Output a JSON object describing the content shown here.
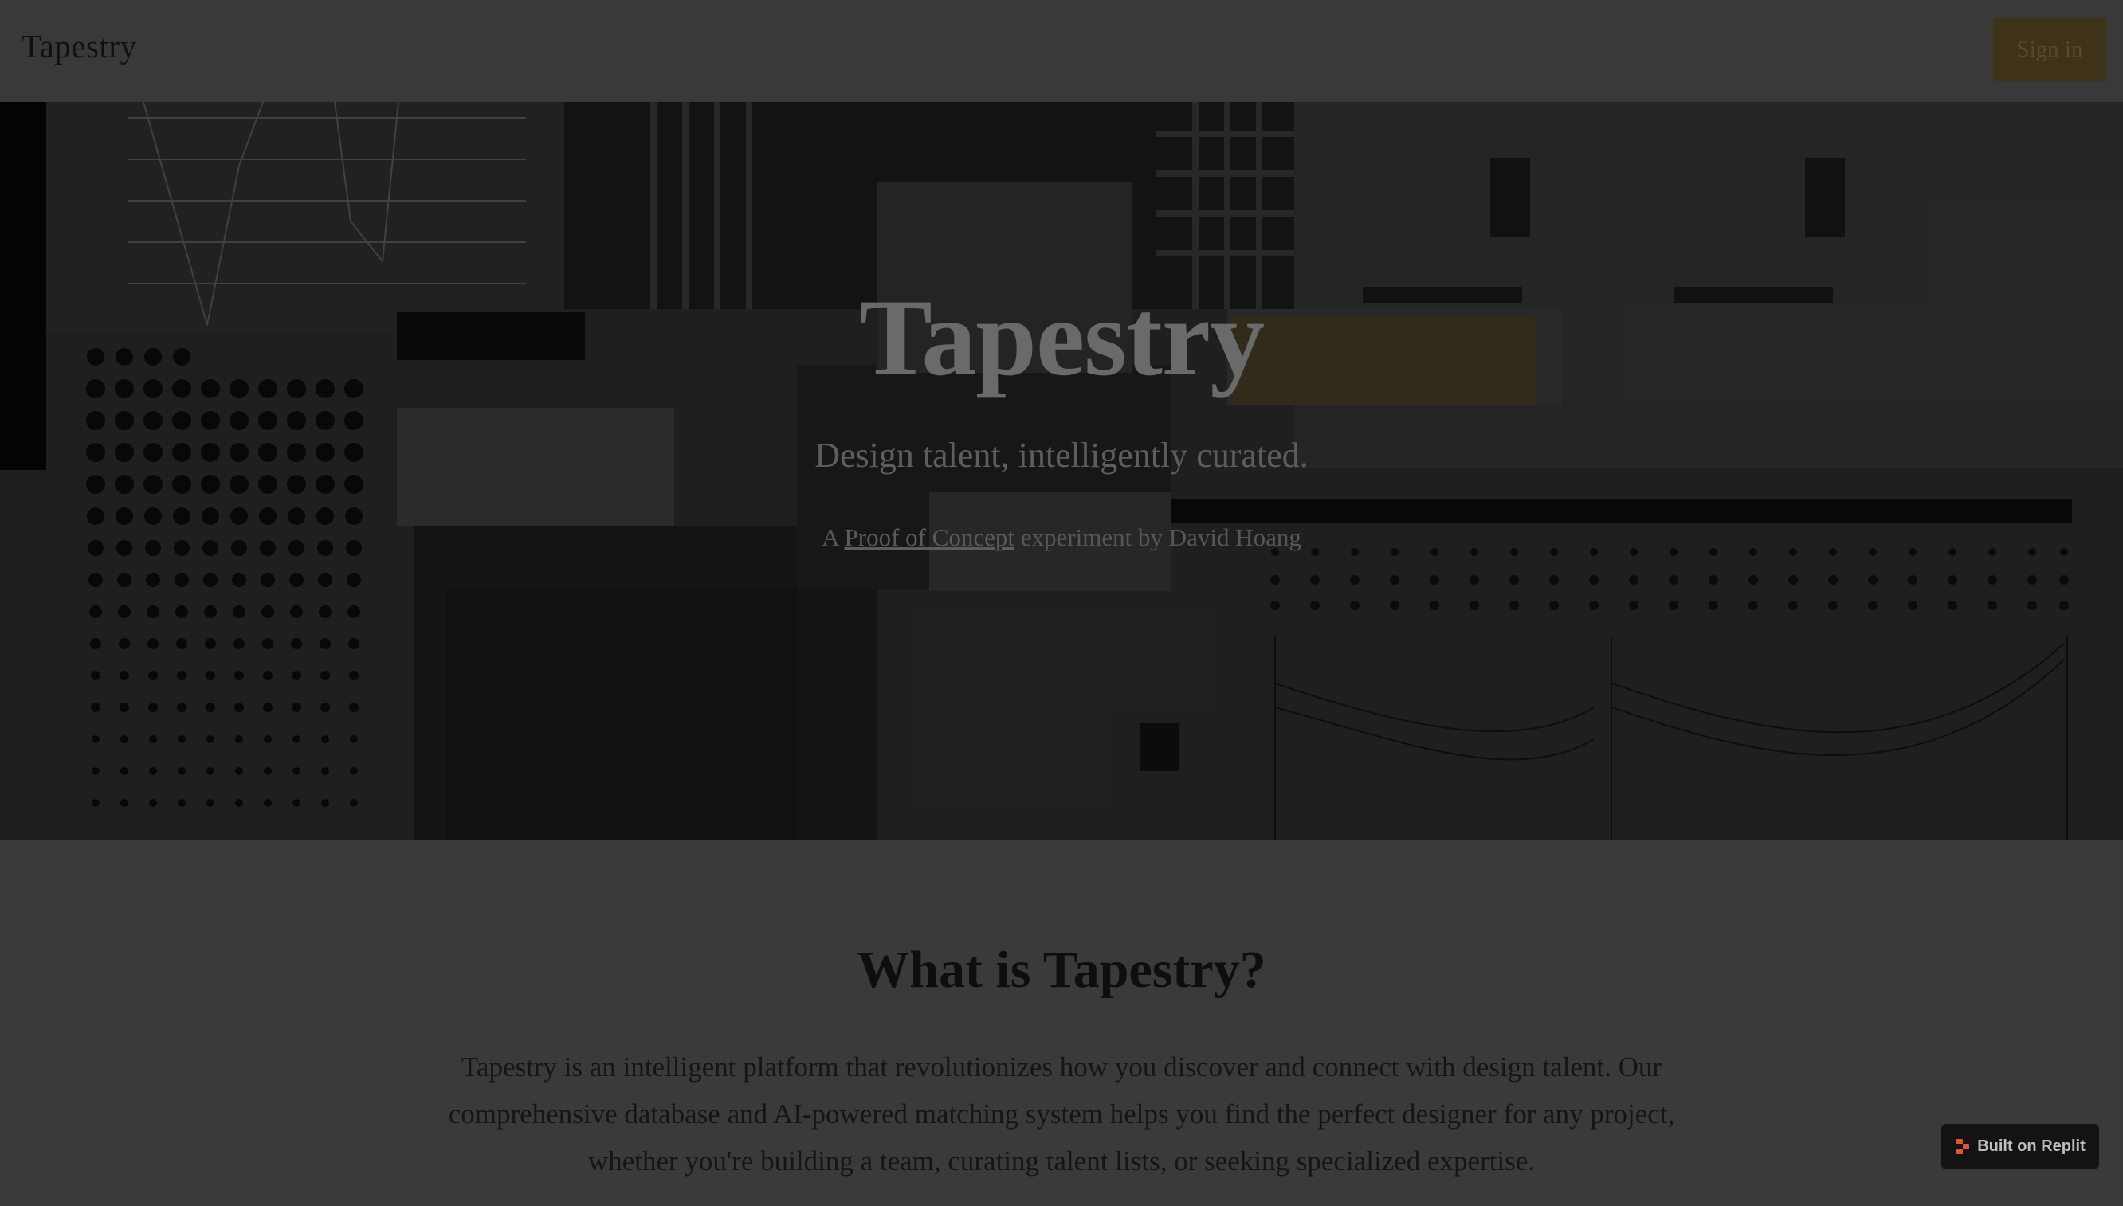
{
  "header": {
    "brand": "Tapestry",
    "sign_in_label": "Sign in"
  },
  "hero": {
    "title": "Tapestry",
    "subtitle": "Design talent, intelligently curated.",
    "credit_prefix": "A ",
    "credit_link": "Proof of Concept",
    "credit_suffix": " experiment by David Hoang"
  },
  "about": {
    "heading": "What is Tapestry?",
    "body": "Tapestry is an intelligent platform that revolutionizes how you discover and connect with design talent. Our comprehensive database and AI-powered matching system helps you find the perfect designer for any project, whether you're building a team, curating talent lists, or seeking specialized expertise."
  },
  "badge": {
    "label": "Built on Replit",
    "icon": "replit-icon"
  },
  "colors": {
    "overlay": "#3a3a3a",
    "accent_dimmed": "#3e3218",
    "badge_bg": "#131313"
  }
}
